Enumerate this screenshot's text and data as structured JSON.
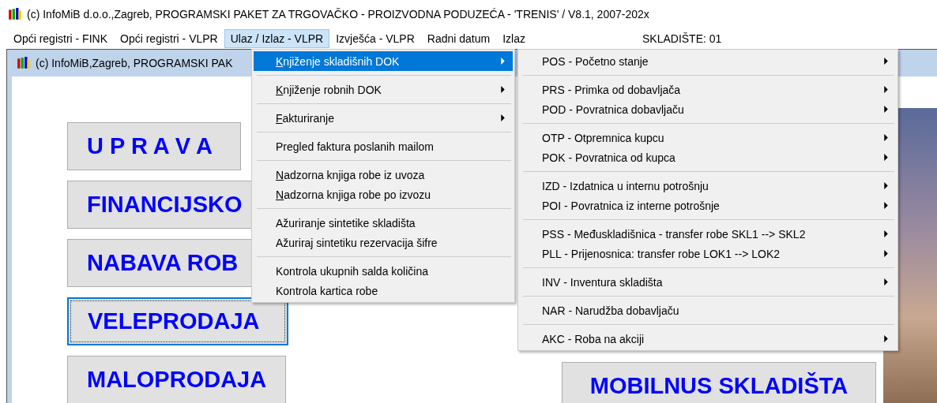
{
  "window": {
    "title": "(c) InfoMiB d.o.o.,Zagreb, PROGRAMSKI PAKET ZA TRGOVAČKO - PROIZVODNA PODUZEĆA - 'TRENIS' / V8.1, 2007-202x"
  },
  "menubar": {
    "items": [
      {
        "label": "Opći registri - FINK",
        "selected": false
      },
      {
        "label": "Opći registri - VLPR",
        "selected": false
      },
      {
        "label": "Ulaz / Izlaz - VLPR",
        "selected": true
      },
      {
        "label": "Izvješća - VLPR",
        "selected": false
      },
      {
        "label": "Radni datum",
        "selected": false
      },
      {
        "label": "Izlaz",
        "selected": false
      }
    ],
    "warehouse": "SKLADIŠTE:  01"
  },
  "dropdown": {
    "groups": [
      [
        {
          "label": "Knjiženje skladišnih DOK",
          "mnemonic": true,
          "submenu": true,
          "selected": true
        }
      ],
      [
        {
          "label": "Knjiženje robnih DOK",
          "mnemonic": true,
          "submenu": true,
          "selected": false
        }
      ],
      [
        {
          "label": "Fakturiranje",
          "mnemonic": true,
          "submenu": true,
          "selected": false
        }
      ],
      [
        {
          "label": "Pregled faktura poslanih mailom",
          "mnemonic": false,
          "submenu": false,
          "selected": false
        }
      ],
      [
        {
          "label": "Nadzorna knjiga robe iz uvoza",
          "mnemonic": true,
          "submenu": false,
          "selected": false
        },
        {
          "label": "Nadzorna knjiga robe po izvozu",
          "mnemonic": true,
          "submenu": false,
          "selected": false
        }
      ],
      [
        {
          "label": "Ažuriranje sintetike skladišta",
          "mnemonic": false,
          "submenu": false,
          "selected": false
        },
        {
          "label": "Ažuriraj sintetiku rezervacija šifre",
          "mnemonic": false,
          "submenu": false,
          "selected": false
        }
      ],
      [
        {
          "label": "Kontrola ukupnih salda količina",
          "mnemonic": false,
          "submenu": false,
          "selected": false
        },
        {
          "label": "Kontrola kartica robe",
          "mnemonic": false,
          "submenu": false,
          "selected": false
        }
      ]
    ]
  },
  "submenu": {
    "groups": [
      [
        {
          "label": "POS - Početno stanje",
          "submenu": true
        }
      ],
      [
        {
          "label": "PRS - Primka od dobavljača",
          "submenu": true
        },
        {
          "label": "POD - Povratnica dobavljaču",
          "submenu": true
        }
      ],
      [
        {
          "label": "OTP - Otpremnica kupcu",
          "submenu": true
        },
        {
          "label": "POK - Povratnica od kupca",
          "submenu": true
        }
      ],
      [
        {
          "label": "IZD - Izdatnica u internu potrošnju",
          "submenu": true
        },
        {
          "label": "POI - Povratnica iz interne potrošnje",
          "submenu": true
        }
      ],
      [
        {
          "label": "PSS - Međuskladišnica - transfer robe SKL1 --> SKL2",
          "submenu": true
        },
        {
          "label": "PLL - Prijenosnica: transfer robe LOK1 --> LOK2",
          "submenu": true
        }
      ],
      [
        {
          "label": "INV - Inventura skladišta",
          "submenu": true
        }
      ],
      [
        {
          "label": "NAR - Narudžba dobavljaču",
          "submenu": false
        }
      ],
      [
        {
          "label": "AKC - Roba na akciji",
          "submenu": true
        }
      ]
    ]
  },
  "child_window": {
    "title": "(c) InfoMiB,Zagreb, PROGRAMSKI PAK",
    "left_buttons": [
      {
        "label": "U P R A V A",
        "focused": false
      },
      {
        "label": "FINANCIJSKO",
        "focused": false
      },
      {
        "label": "NABAVA ROB",
        "focused": false
      },
      {
        "label": "VELEPRODAJA",
        "focused": true
      },
      {
        "label": "MALOPRODAJA",
        "focused": false
      }
    ],
    "right_buttons": [
      {
        "label": "MOBILNUS SKLADIŠTA",
        "focused": false
      }
    ]
  }
}
